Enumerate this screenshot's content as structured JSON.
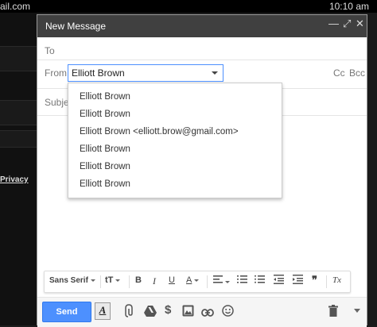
{
  "status_bar": {
    "left_text": "ail.com",
    "time": "10:10 am"
  },
  "left_pane": {
    "privacy_link": "Privacy"
  },
  "compose": {
    "title": "New Message",
    "controls": {
      "minimize": "—",
      "popout": "⤢",
      "close": "✕"
    },
    "to_label": "To",
    "from_label": "From",
    "from_value": "Elliott Brown",
    "cc_label": "Cc",
    "bcc_label": "Bcc",
    "subject_label": "Subject",
    "from_options": [
      "Elliott Brown",
      "Elliott Brown",
      "Elliott Brown <elliott.brow@gmail.com>",
      "Elliott Brown",
      "Elliott Brown",
      "Elliott Brown"
    ],
    "format_toolbar": {
      "font_family": "Sans Serif",
      "font_size_icon": "tT",
      "bold": "B",
      "italic": "I",
      "underline": "U",
      "text_color": "A",
      "align_icon": "align-icon",
      "numbered_list_icon": "numbered-list-icon",
      "bulleted_list_icon": "bulleted-list-icon",
      "indent_less_icon": "indent-less-icon",
      "indent_more_icon": "indent-more-icon",
      "quote": "❞",
      "clear_format": "Tx"
    },
    "bottom_toolbar": {
      "send_label": "Send",
      "format_toggle": "A",
      "more_icon": "chevron-down-icon"
    }
  },
  "colors": {
    "send_button": "#4d90fe",
    "title_bar": "#404040",
    "focus_border": "#4d90fe"
  }
}
